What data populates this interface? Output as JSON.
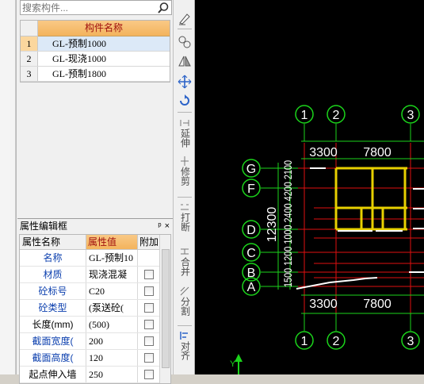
{
  "search": {
    "placeholder": "搜索构件..."
  },
  "components": {
    "header": "构件名称",
    "rows": [
      {
        "index": "1",
        "name": "GL-预制1000",
        "selected": true
      },
      {
        "index": "2",
        "name": "GL-现浇1000",
        "selected": false
      },
      {
        "index": "3",
        "name": "GL-预制1800",
        "selected": false
      }
    ]
  },
  "properties": {
    "title": "属性编辑框",
    "pin_glyph": "𝟜",
    "close_glyph": "×",
    "col_name": "属性名称",
    "col_value": "属性值",
    "col_add": "附加",
    "rows": [
      {
        "name": "名称",
        "value": "GL-预制10",
        "blue": true,
        "checkbox": false
      },
      {
        "name": "材质",
        "value": "现浇混凝",
        "blue": true,
        "checkbox": true
      },
      {
        "name": "砼标号",
        "value": "C20",
        "blue": true,
        "checkbox": true
      },
      {
        "name": "砼类型",
        "value": "(泵送砼(",
        "blue": true,
        "checkbox": true
      },
      {
        "name": "长度(mm)",
        "value": "(500)",
        "blue": false,
        "checkbox": true
      },
      {
        "name": "截面宽度(",
        "value": "200",
        "blue": true,
        "checkbox": true
      },
      {
        "name": "截面高度(",
        "value": "120",
        "blue": true,
        "checkbox": true
      },
      {
        "name": "起点伸入墙",
        "value": "250",
        "blue": false,
        "checkbox": true
      }
    ]
  },
  "toolbar": {
    "extend_label": "延伸",
    "trim_label": "修剪",
    "break_label": "打断",
    "merge_label": "合并",
    "split_label": "分割",
    "align_label": "对齐"
  },
  "drawing": {
    "axis_top": [
      "1",
      "2",
      "3"
    ],
    "axis_bottom": [
      "1",
      "2",
      "3"
    ],
    "axis_left": [
      "G",
      "F",
      "D",
      "C",
      "B",
      "A"
    ],
    "dim_top": [
      "3300",
      "7800"
    ],
    "dim_bottom": [
      "3300",
      "7800"
    ],
    "dim_left_total": "12300",
    "dim_left_parts": "1500  1200  1000  2400  4200  2100",
    "colors": {
      "axis_circle": "#1bd41b",
      "grid_line": "#e01010",
      "wall": "#e8d000",
      "white_line": "#ffffff"
    }
  }
}
